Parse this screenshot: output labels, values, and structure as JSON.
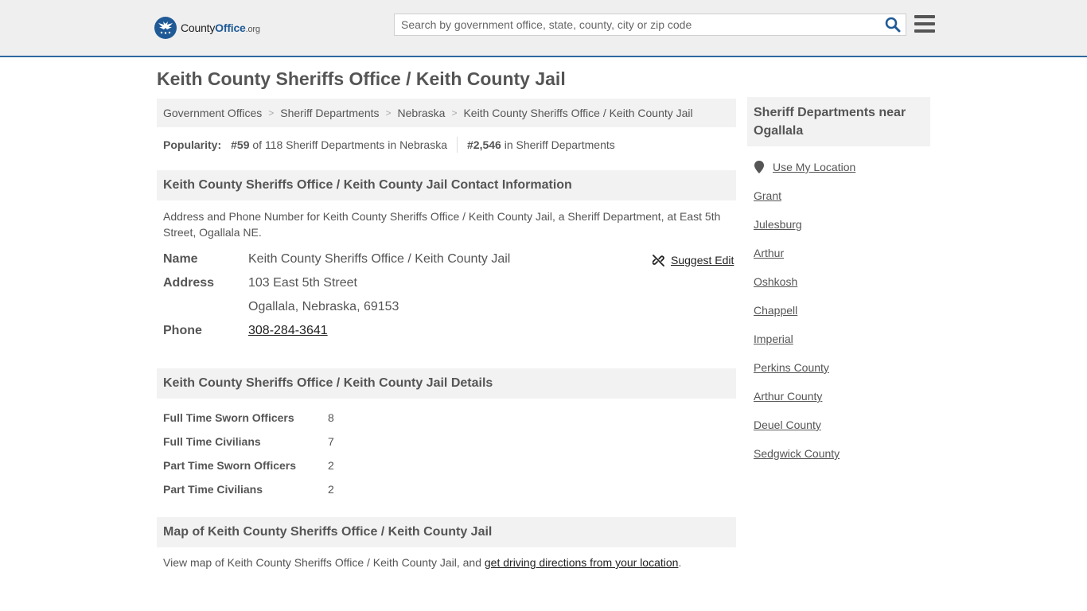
{
  "header": {
    "logo_primary": "County",
    "logo_secondary": "Office",
    "logo_suffix": ".org",
    "search_placeholder": "Search by government office, state, county, city or zip code",
    "brand_color": "#1f5a96"
  },
  "page_title": "Keith County Sheriffs Office / Keith County Jail",
  "breadcrumb": [
    "Government Offices",
    "Sheriff Departments",
    "Nebraska",
    "Keith County Sheriffs Office / Keith County Jail"
  ],
  "popularity": {
    "label": "Popularity:",
    "state_rank": "#59",
    "state_text": "of 118 Sheriff Departments in Nebraska",
    "national_rank": "#2,546",
    "national_text": "in Sheriff Departments"
  },
  "contact": {
    "heading": "Keith County Sheriffs Office / Keith County Jail Contact Information",
    "description": "Address and Phone Number for Keith County Sheriffs Office / Keith County Jail, a Sheriff Department, at East 5th Street, Ogallala NE.",
    "name_label": "Name",
    "name_value": "Keith County Sheriffs Office / Keith County Jail",
    "suggest_edit": "Suggest Edit",
    "address_label": "Address",
    "address_line1": "103 East 5th Street",
    "address_line2": "Ogallala, Nebraska, 69153",
    "phone_label": "Phone",
    "phone_value": "308-284-3641"
  },
  "details": {
    "heading": "Keith County Sheriffs Office / Keith County Jail Details",
    "rows": [
      {
        "label": "Full Time Sworn Officers",
        "value": "8"
      },
      {
        "label": "Full Time Civilians",
        "value": "7"
      },
      {
        "label": "Part Time Sworn Officers",
        "value": "2"
      },
      {
        "label": "Part Time Civilians",
        "value": "2"
      }
    ]
  },
  "map": {
    "heading": "Map of Keith County Sheriffs Office / Keith County Jail",
    "text_before": "View map of Keith County Sheriffs Office / Keith County Jail, and",
    "link": "get driving directions from your location",
    "text_after": "."
  },
  "sidebar": {
    "heading": "Sheriff Departments near Ogallala",
    "use_location": "Use My Location",
    "links": [
      "Grant",
      "Julesburg",
      "Arthur",
      "Oshkosh",
      "Chappell",
      "Imperial",
      "Perkins County",
      "Arthur County",
      "Deuel County",
      "Sedgwick County"
    ]
  }
}
